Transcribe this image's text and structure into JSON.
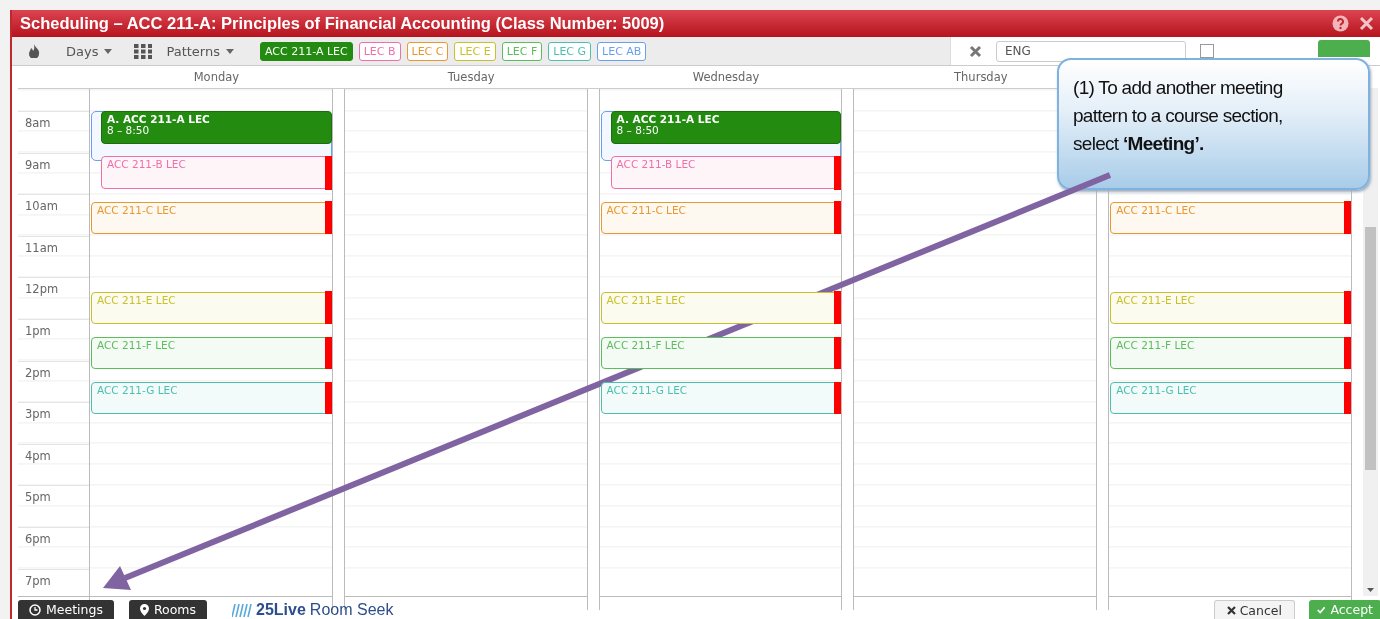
{
  "window": {
    "title": "Scheduling – ACC 211-A: Principles of Financial Accounting (Class Number: 5009)"
  },
  "toolbar": {
    "days_menu": "Days",
    "patterns_menu": "Patterns",
    "chips": [
      {
        "label": "ACC 211-A LEC",
        "color": "#228b10",
        "selected": true
      },
      {
        "label": "LEC B",
        "color": "#f06fa8",
        "selected": false
      },
      {
        "label": "LEC C",
        "color": "#e8982e",
        "selected": false
      },
      {
        "label": "LEC E",
        "color": "#c9c02a",
        "selected": false
      },
      {
        "label": "LEC F",
        "color": "#5cbd5c",
        "selected": false
      },
      {
        "label": "LEC G",
        "color": "#4cc0b0",
        "selected": false
      },
      {
        "label": "LEC AB",
        "color": "#6a9ff0",
        "selected": false
      }
    ],
    "filter_value": "ENG",
    "checkbox": {
      "checked": false
    }
  },
  "calendar": {
    "hours": [
      "8am",
      "9am",
      "10am",
      "11am",
      "12pm",
      "1pm",
      "2pm",
      "3pm",
      "4pm",
      "5pm",
      "6pm",
      "7pm"
    ],
    "days": [
      {
        "name": "Monday",
        "events": [
          {
            "kind": "selected",
            "label": "A. ACC 211-A LEC",
            "time": "8 – 8:50",
            "color": "#228b10",
            "conflict": false
          },
          {
            "kind": "section",
            "label": "ACC 211-B LEC",
            "color": "#f06fa8",
            "conflict": true
          },
          {
            "kind": "section",
            "label": "ACC 211-C LEC",
            "color": "#e8982e",
            "conflict": true
          },
          {
            "kind": "section",
            "label": "ACC 211-E LEC",
            "color": "#c9c02a",
            "conflict": true
          },
          {
            "kind": "section",
            "label": "ACC 211-F LEC",
            "color": "#5cbd5c",
            "conflict": true
          },
          {
            "kind": "section",
            "label": "ACC 211-G LEC",
            "color": "#4cc0b0",
            "conflict": true
          }
        ]
      },
      {
        "name": "Tuesday"
      },
      {
        "name": "Wednesday",
        "events": [
          {
            "kind": "selected",
            "label": "A. ACC 211-A LEC",
            "time": "8 – 8:50",
            "color": "#228b10",
            "conflict": false
          },
          {
            "kind": "section",
            "label": "ACC 211-B LEC",
            "color": "#f06fa8",
            "conflict": true
          },
          {
            "kind": "section",
            "label": "ACC 211-C LEC",
            "color": "#e8982e",
            "conflict": true
          },
          {
            "kind": "section",
            "label": "ACC 211-E LEC",
            "color": "#c9c02a",
            "conflict": true
          },
          {
            "kind": "section",
            "label": "ACC 211-F LEC",
            "color": "#5cbd5c",
            "conflict": true
          },
          {
            "kind": "section",
            "label": "ACC 211-G LEC",
            "color": "#4cc0b0",
            "conflict": true
          }
        ]
      },
      {
        "name": "Thursday"
      },
      {
        "events": [
          {
            "kind": "section",
            "label": "ACC 211-C LEC",
            "color": "#e8982e",
            "conflict": true
          },
          {
            "kind": "section",
            "label": "ACC 211-E LEC",
            "color": "#c9c02a",
            "conflict": true
          },
          {
            "kind": "section",
            "label": "ACC 211-F LEC",
            "color": "#5cbd5c",
            "conflict": true
          },
          {
            "kind": "section",
            "label": "ACC 211-G LEC",
            "color": "#4cc0b0",
            "conflict": true
          }
        ]
      }
    ]
  },
  "footer": {
    "meetings_button": "Meetings",
    "rooms_button": "Rooms",
    "logo_brand": "25Live",
    "logo_product": "Room Seek",
    "cancel_button": "Cancel",
    "accept_button": "Accept"
  },
  "callout": {
    "text": "(1) To add another meeting pattern to a course section, select **‘Meeting’.**"
  }
}
